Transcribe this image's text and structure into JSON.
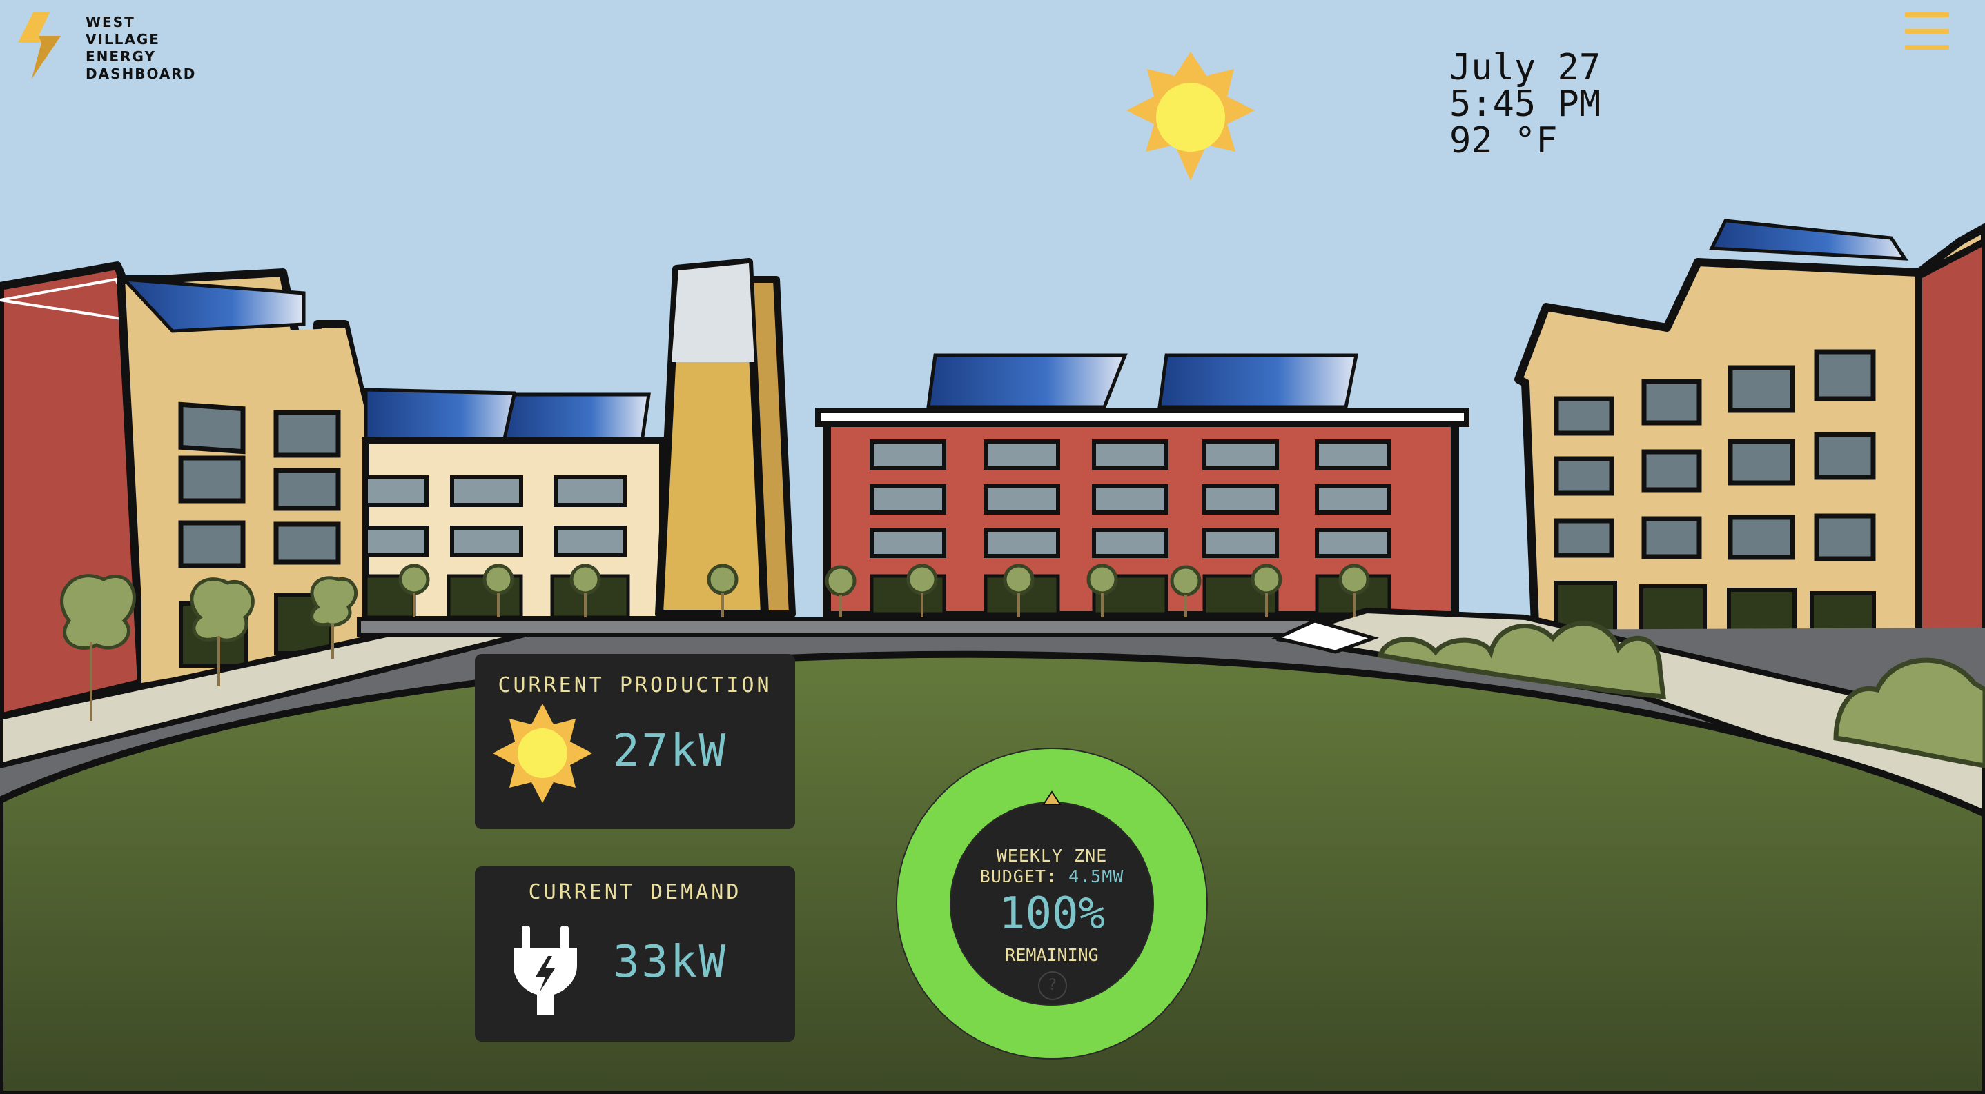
{
  "app": {
    "brand_lines": [
      "WEST",
      "VILLAGE",
      "ENERGY",
      "DASHBOARD"
    ],
    "logo_icon": "lightning-bolt-icon",
    "menu_icon": "hamburger-menu-icon"
  },
  "header": {
    "date": "July 27",
    "time": "5:45 PM",
    "temperature": "92 °F",
    "weather_icon": "sun-icon"
  },
  "production": {
    "title": "CURRENT PRODUCTION",
    "value": "27kW",
    "icon": "sun-icon"
  },
  "demand": {
    "title": "CURRENT DEMAND",
    "value": "33kW",
    "icon": "plug-icon"
  },
  "budget": {
    "line1": "WEEKLY ZNE",
    "line2_label": "BUDGET: ",
    "line2_value": "4.5MW",
    "percent": "100%",
    "status": "REMAINING",
    "help_glyph": "?",
    "remaining_fraction": 1.0
  },
  "colors": {
    "sky": "#b9d3e8",
    "grass_top": "#647a3c",
    "grass_bottom": "#3e4a26",
    "accent_yellow": "#f4bf47",
    "gauge_green": "#7ad84a",
    "value_cyan": "#7cc6cb",
    "panel_bg": "#232323"
  }
}
